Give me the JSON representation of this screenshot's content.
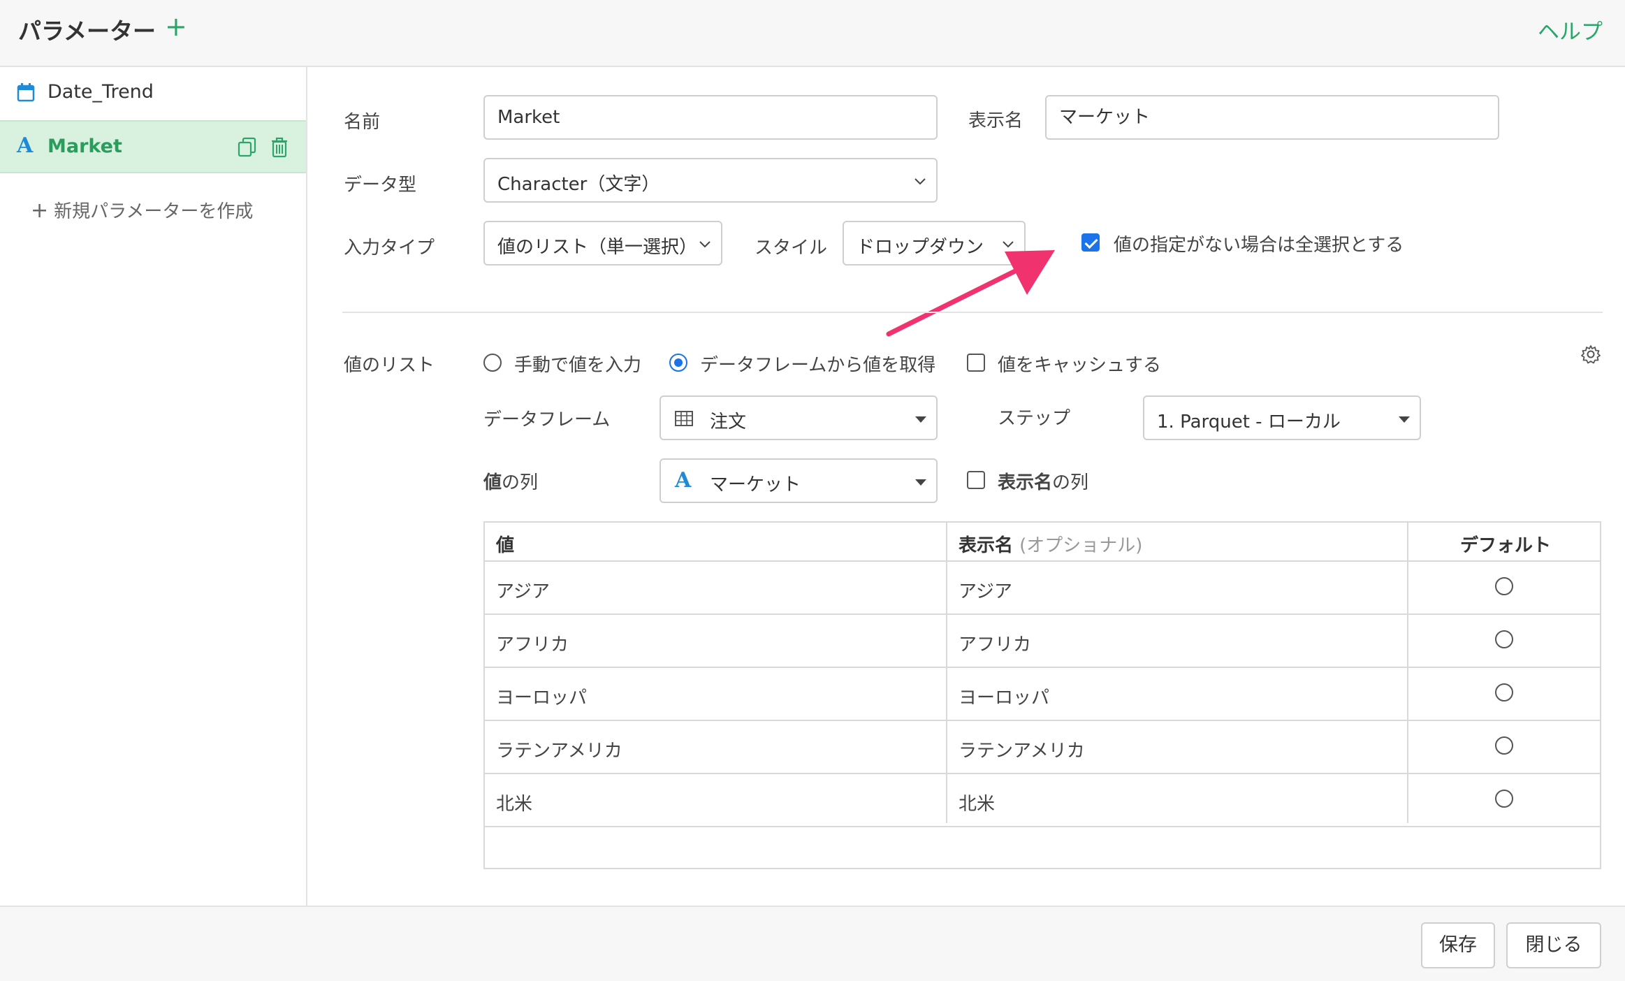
{
  "header": {
    "title": "パラメーター",
    "add_label": "+",
    "help_label": "ヘルプ"
  },
  "sidebar": {
    "items": [
      {
        "icon": "calendar-icon",
        "label": "Date_Trend"
      },
      {
        "icon": "character-type-icon",
        "icon_glyph": "A",
        "label": "Market"
      }
    ],
    "new_param_plus": "+",
    "new_param_label": "新規パラメーターを作成"
  },
  "form": {
    "name_label": "名前",
    "name_value": "Market",
    "display_name_label": "表示名",
    "display_name_value": "マーケット",
    "data_type_label": "データ型",
    "data_type_value": "Character（文字）",
    "input_type_label": "入力タイプ",
    "input_type_value": "値のリスト（単一選択）",
    "style_label": "スタイル",
    "style_value": "ドロップダウン",
    "select_all_label": "値の指定がない場合は全選択とする",
    "select_all_checked": true
  },
  "value_list": {
    "label": "値のリスト",
    "manual_label": "手動で値を入力",
    "from_df_label": "データフレームから値を取得",
    "cache_label": "値をキャッシュする",
    "dataframe_label": "データフレーム",
    "dataframe_value": "注文",
    "step_label": "ステップ",
    "step_value": "1. Parquet - ローカル",
    "value_col_label_bold": "値",
    "value_col_label_rest": "の列",
    "value_col_icon_glyph": "A",
    "value_col_value": "マーケット",
    "display_col_label_bold": "表示名",
    "display_col_label_rest": "の列"
  },
  "table": {
    "headers": {
      "value": "値",
      "display": "表示名",
      "display_optional": "(オプショナル)",
      "default": "デフォルト"
    },
    "rows": [
      {
        "value": "アジア",
        "display": "アジア"
      },
      {
        "value": "アフリカ",
        "display": "アフリカ"
      },
      {
        "value": "ヨーロッパ",
        "display": "ヨーロッパ"
      },
      {
        "value": "ラテンアメリカ",
        "display": "ラテンアメリカ"
      },
      {
        "value": "北米",
        "display": "北米"
      }
    ]
  },
  "footer": {
    "save_label": "保存",
    "close_label": "閉じる"
  },
  "colors": {
    "accent": "#2aa66b",
    "selected_bg": "#d9f2df",
    "checkbox": "#1a73e8",
    "annotation_arrow": "#f0326f"
  }
}
